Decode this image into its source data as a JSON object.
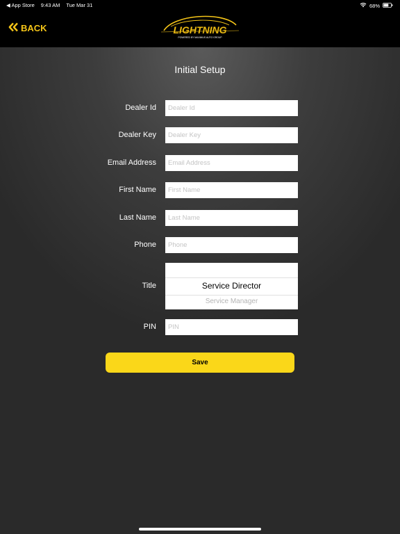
{
  "status": {
    "carrier": "◀ App Store",
    "time": "9:43 AM",
    "date": "Tue Mar 31",
    "battery": "68%",
    "battery_level": 0.68
  },
  "nav": {
    "back_label": "BACK",
    "logo_text": "LIGHTNING",
    "logo_subtext": "POWERED BY MAXIMUS AUTO GROUP"
  },
  "page": {
    "title": "Initial Setup"
  },
  "form": {
    "dealer_id": {
      "label": "Dealer Id",
      "placeholder": "Dealer Id",
      "value": ""
    },
    "dealer_key": {
      "label": "Dealer Key",
      "placeholder": "Dealer Key",
      "value": ""
    },
    "email": {
      "label": "Email Address",
      "placeholder": "Email Address",
      "value": ""
    },
    "first_name": {
      "label": "First Name",
      "placeholder": "First Name",
      "value": ""
    },
    "last_name": {
      "label": "Last Name",
      "placeholder": "Last Name",
      "value": ""
    },
    "phone": {
      "label": "Phone",
      "placeholder": "Phone",
      "value": ""
    },
    "title": {
      "label": "Title",
      "selected": "Service Director",
      "next_option": "Service Manager"
    },
    "pin": {
      "label": "PIN",
      "placeholder": "PIN",
      "value": ""
    },
    "save_label": "Save"
  },
  "colors": {
    "accent": "#fad719",
    "topbar": "#000000",
    "background": "#2b2b2b"
  }
}
